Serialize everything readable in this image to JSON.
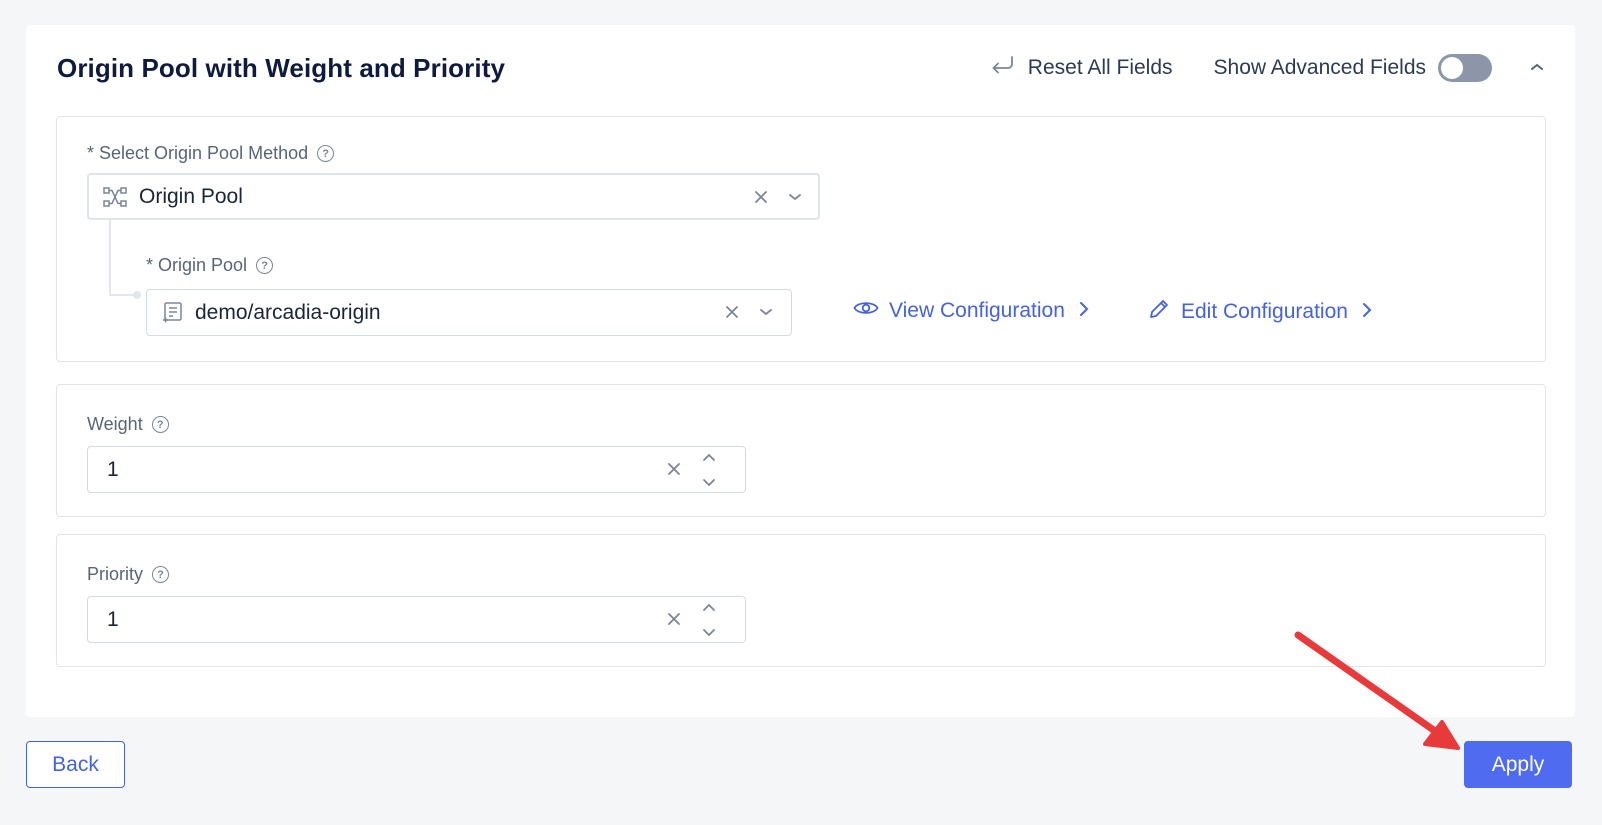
{
  "header": {
    "title": "Origin Pool with Weight and Priority",
    "reset_label": "Reset All Fields",
    "advanced_label": "Show Advanced Fields",
    "advanced_enabled": false
  },
  "origin_method": {
    "label": "* Select Origin Pool Method",
    "value": "Origin Pool",
    "icon": "network-icon"
  },
  "origin_pool": {
    "label": "* Origin Pool",
    "value": "demo/arcadia-origin",
    "icon": "document-icon",
    "view_label": "View Configuration",
    "edit_label": "Edit Configuration"
  },
  "weight": {
    "label": "Weight",
    "value": "1"
  },
  "priority": {
    "label": "Priority",
    "value": "1"
  },
  "footer": {
    "back_label": "Back",
    "apply_label": "Apply"
  },
  "colors": {
    "accent": "#4f6bf0",
    "link": "#4562e0",
    "annotation": "#e83a3a"
  }
}
